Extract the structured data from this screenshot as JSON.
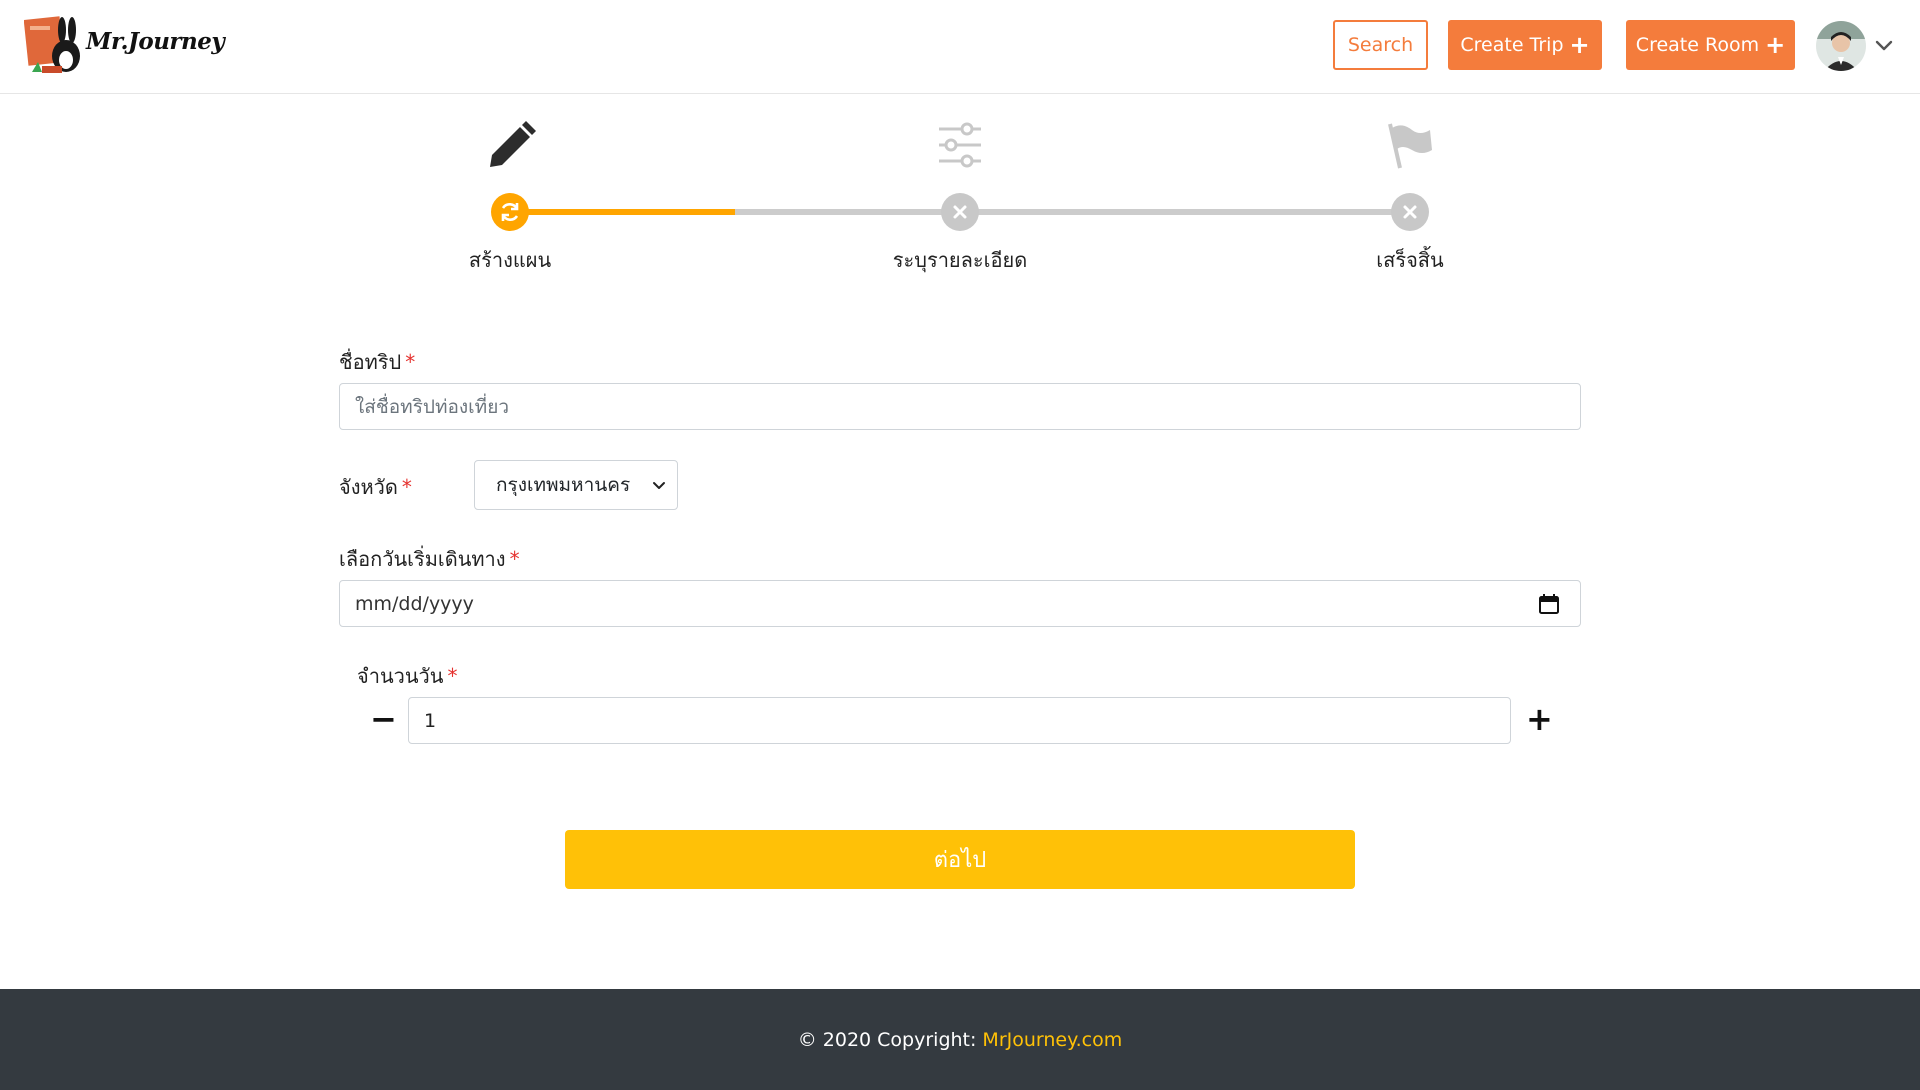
{
  "header": {
    "logo_text": "Mr.Journey",
    "search_label": "Search",
    "create_trip_label": "Create Trip",
    "create_room_label": "Create Room",
    "accent_color": "#f47c3c"
  },
  "stepper": {
    "steps": [
      {
        "label": "สร้างแผน",
        "icon": "pencil-icon",
        "status": "current",
        "status_icon": "sync-icon"
      },
      {
        "label": "ระบุรายละเอียด",
        "icon": "sliders-icon",
        "status": "pending",
        "status_icon": "x-icon"
      },
      {
        "label": "เสร็จสิ้น",
        "icon": "flag-icon",
        "status": "pending",
        "status_icon": "x-icon"
      }
    ],
    "progress_fraction": 0.25,
    "active_color": "#ffa500",
    "inactive_color": "#cccccc"
  },
  "form": {
    "trip_name": {
      "label": "ชื่อทริป",
      "required": "*",
      "placeholder": "ใส่ชื่อทริปท่องเที่ยว",
      "value": ""
    },
    "province": {
      "label": "จังหวัด",
      "required": "*",
      "selected": "กรุงเทพมหานคร"
    },
    "start_date": {
      "label": "เลือกวันเริ่มเดินทาง",
      "required": "*",
      "placeholder": "mm/dd/yyyy"
    },
    "days": {
      "label": "จำนวนวัน",
      "required": "*",
      "value": "1",
      "minus": "−",
      "plus": "+"
    },
    "next_label": "ต่อไป",
    "next_color": "#ffc107"
  },
  "footer": {
    "copyright": "© 2020 Copyright:",
    "link_text": "MrJourney.com"
  }
}
